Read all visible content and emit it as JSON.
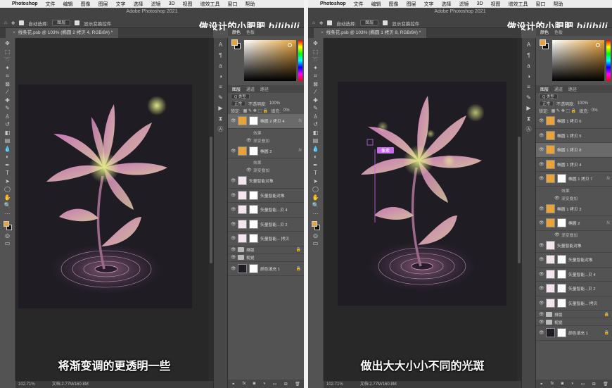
{
  "menubar": {
    "app": "Photoshop",
    "items": [
      "文件",
      "编辑",
      "图像",
      "图层",
      "文字",
      "选择",
      "滤镜",
      "3D",
      "视图",
      "增效工具",
      "窗口",
      "帮助"
    ]
  },
  "window_title": "Adobe Photoshop 2021",
  "watermark": {
    "text": "做设计的小肥肥",
    "logo": "bilibili"
  },
  "options": {
    "auto_select_label": "自动选择:",
    "auto_select_value": "图层",
    "show_transform_label": "显示变换控件"
  },
  "left": {
    "doc_tab": "线条花.psb @ 103% (椭圆 2 拷贝 4, RGB/8#) *",
    "caption": "将渐变调的更透明一些",
    "status_zoom": "102.71%",
    "status_doc": "文档:2.77M/160.8M",
    "layers": [
      {
        "name": "椭圆 2 拷贝 4",
        "kind": "shape",
        "fx": "fx",
        "highlight": true
      },
      {
        "name": "效果",
        "kind": "effects"
      },
      {
        "name": "渐变叠加",
        "kind": "effect"
      },
      {
        "name": "椭圆 2",
        "kind": "shape",
        "fx": "fx"
      },
      {
        "name": "效果",
        "kind": "effects"
      },
      {
        "name": "渐变叠加",
        "kind": "effect"
      },
      {
        "name": "矢量智能对象",
        "kind": "smart"
      },
      {
        "name": "矢量智能对象",
        "kind": "smart-mask"
      },
      {
        "name": "矢量智能...贝 4",
        "kind": "smart-mask"
      },
      {
        "name": "矢量智能...贝 2",
        "kind": "smart-mask"
      },
      {
        "name": "矢量智能... 拷贝",
        "kind": "smart-mask"
      },
      {
        "name": "排版",
        "kind": "group",
        "lock": true
      },
      {
        "name": "视觉",
        "kind": "group"
      },
      {
        "name": "颜色填充 1",
        "kind": "fill",
        "lock": true
      }
    ]
  },
  "right": {
    "doc_tab": "线条花.psb @ 103% (椭圆 1 拷贝 8, RGB/8#) *",
    "caption": "做出大大小小不同的光斑",
    "status_zoom": "102.71%",
    "status_doc": "文档:2.77M/160.8M",
    "guide_label": "像素",
    "layers": [
      {
        "name": "椭圆 1 拷贝 6",
        "kind": "shape"
      },
      {
        "name": "椭圆 1 拷贝 5",
        "kind": "shape"
      },
      {
        "name": "椭圆 1 拷贝 8",
        "kind": "shape",
        "highlight": true
      },
      {
        "name": "椭圆 1 拷贝 4",
        "kind": "shape"
      },
      {
        "name": "椭圆 1 拷贝 7",
        "kind": "shape",
        "fx": "fx"
      },
      {
        "name": "效果",
        "kind": "effects"
      },
      {
        "name": "渐变叠加",
        "kind": "effect"
      },
      {
        "name": "椭圆 1 拷贝 3",
        "kind": "shape"
      },
      {
        "name": "椭圆 2",
        "kind": "shape",
        "fx": "fx"
      },
      {
        "name": "渐变叠加",
        "kind": "effect"
      },
      {
        "name": "矢量智能对象",
        "kind": "smart"
      },
      {
        "name": "矢量智能对象",
        "kind": "smart-mask"
      },
      {
        "name": "矢量智能...贝 4",
        "kind": "smart-mask"
      },
      {
        "name": "矢量智能...贝 2",
        "kind": "smart-mask"
      },
      {
        "name": "矢量智能... 拷贝",
        "kind": "smart-mask"
      },
      {
        "name": "排版",
        "kind": "group",
        "lock": true
      },
      {
        "name": "视觉",
        "kind": "group"
      },
      {
        "name": "颜色填充 1",
        "kind": "fill",
        "lock": true
      }
    ]
  },
  "panel": {
    "color_tabs": [
      "颜色",
      "色板"
    ],
    "layer_tabs": [
      "图层",
      "通道",
      "路径"
    ],
    "kind_filter": "Q 类型",
    "blend_mode": "正常",
    "opacity_label": "不透明度:",
    "opacity_value": "100%",
    "lock_label": "锁定:",
    "fill_label": "填充:",
    "fill_value": "0%"
  },
  "colors": {
    "foreground": "#e8a33a",
    "background": "#111111",
    "canvas": "#1f1c23"
  }
}
